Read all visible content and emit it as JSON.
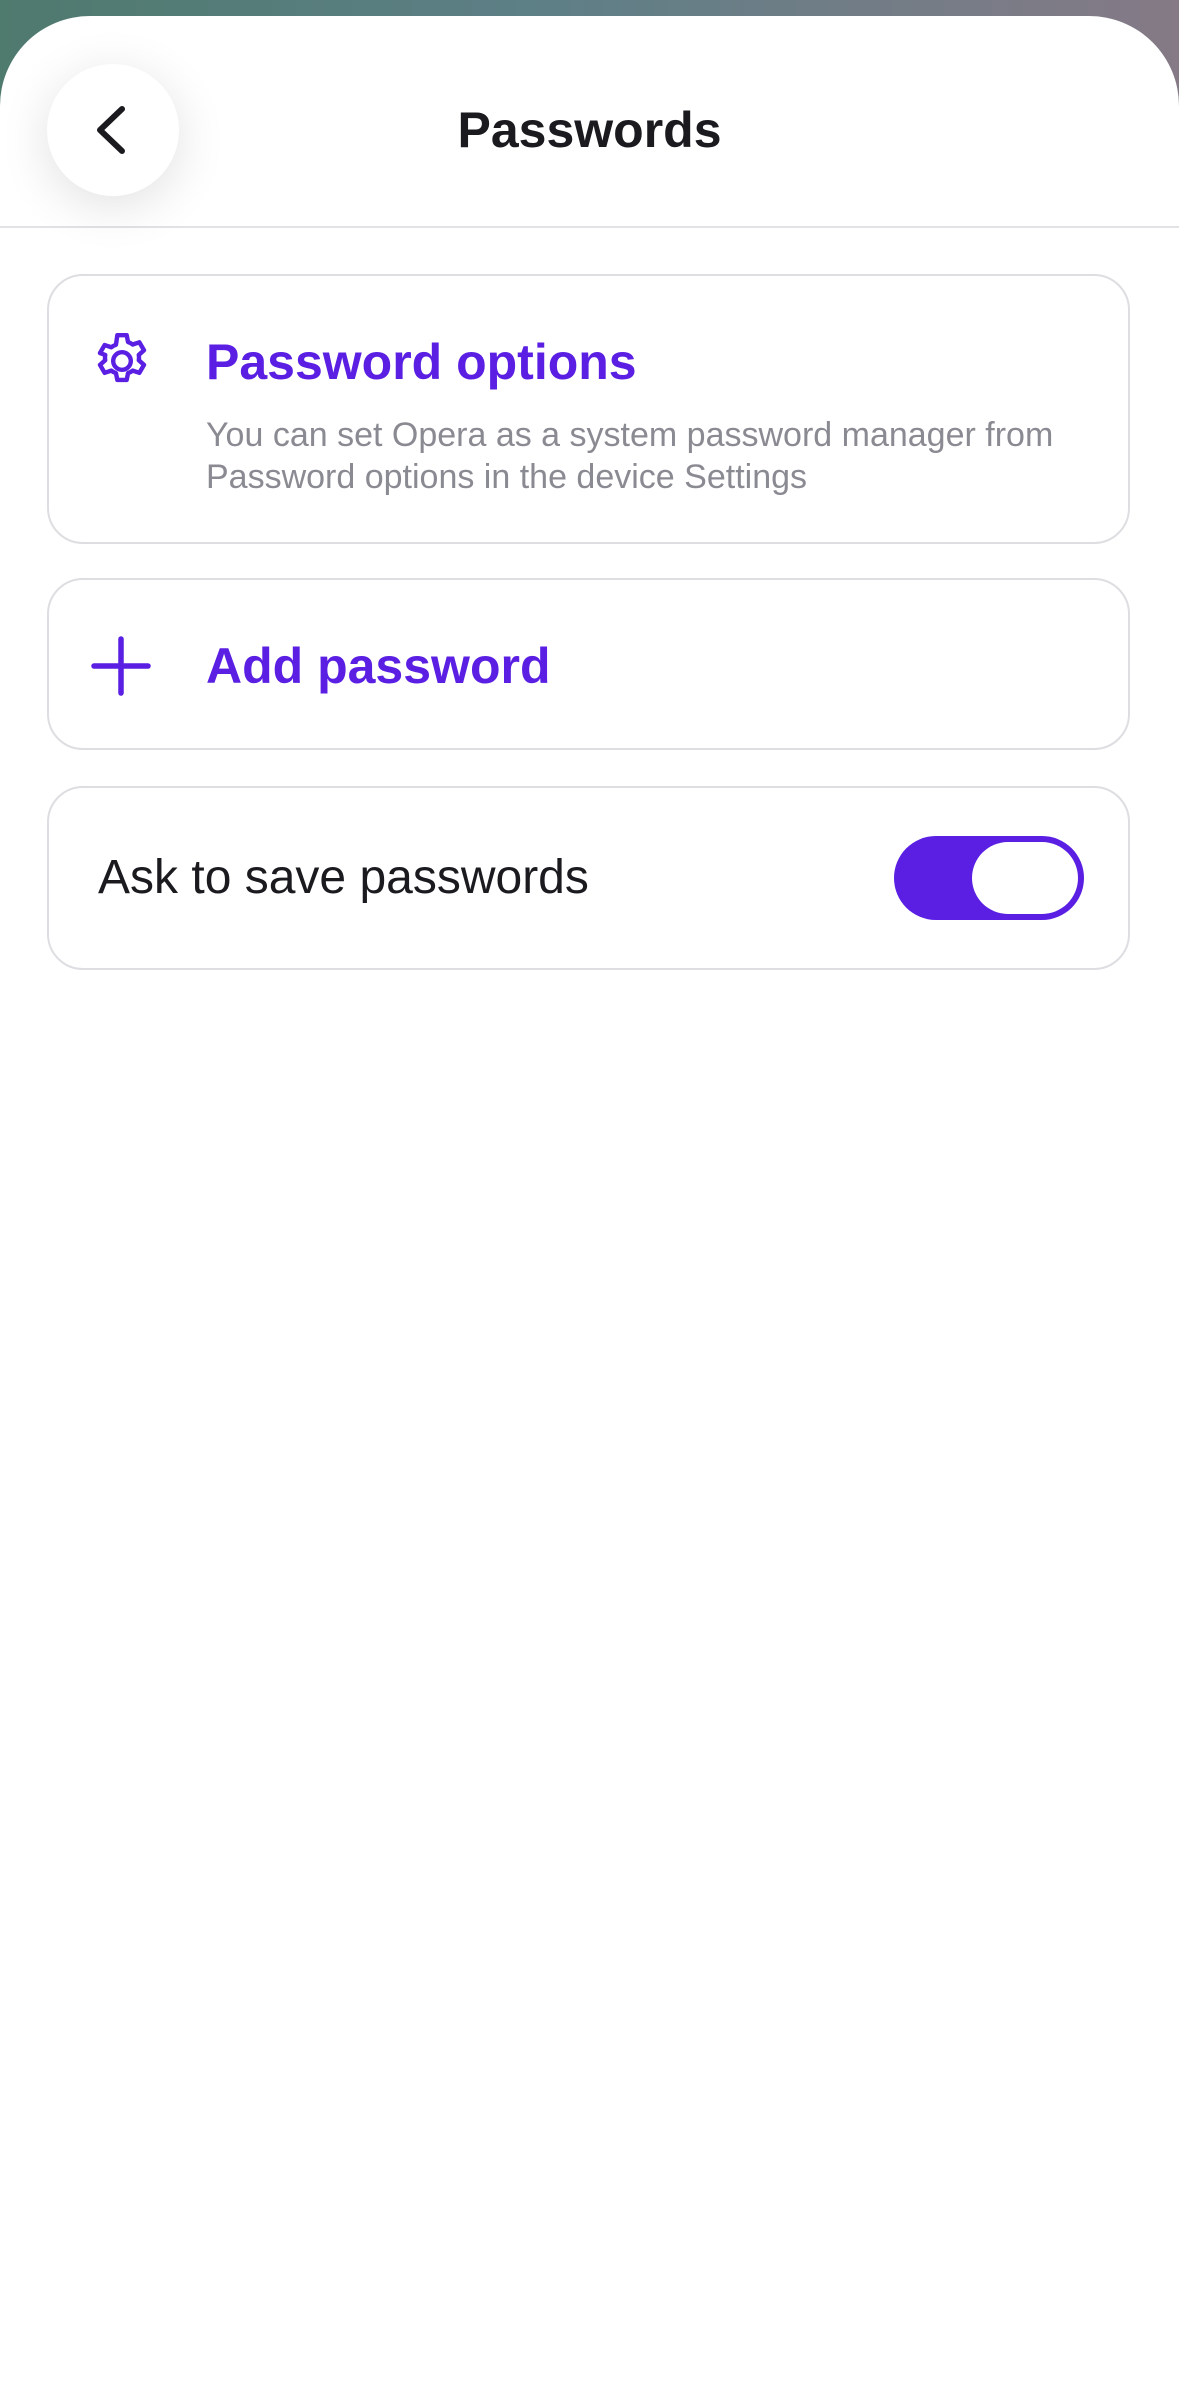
{
  "header": {
    "title": "Passwords",
    "back_icon": "chevron-left-icon"
  },
  "password_options": {
    "title": "Password options",
    "description": "You can set Opera as a system password manager from Password options in the device Settings",
    "icon": "gear-icon"
  },
  "add_password": {
    "label": "Add password",
    "icon": "plus-icon"
  },
  "ask_to_save": {
    "label": "Ask to save passwords",
    "enabled": true
  },
  "colors": {
    "accent": "#5a1fe3",
    "secondary_text": "#8a8a92",
    "primary_text": "#1a1a1f",
    "border": "#dedee2"
  }
}
